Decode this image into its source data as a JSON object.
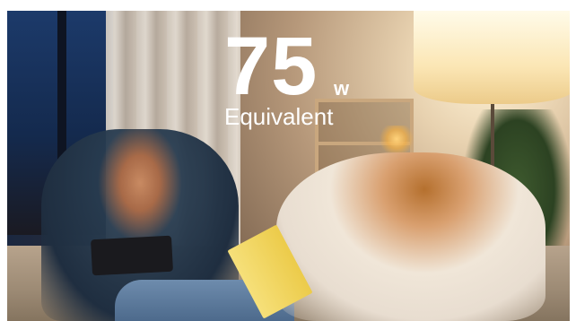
{
  "headline": {
    "wattage": "75",
    "unit": "w",
    "label": "Equivalent"
  },
  "colors": {
    "text": "#ffffff",
    "lamp_glow": "#fbe6b4"
  }
}
